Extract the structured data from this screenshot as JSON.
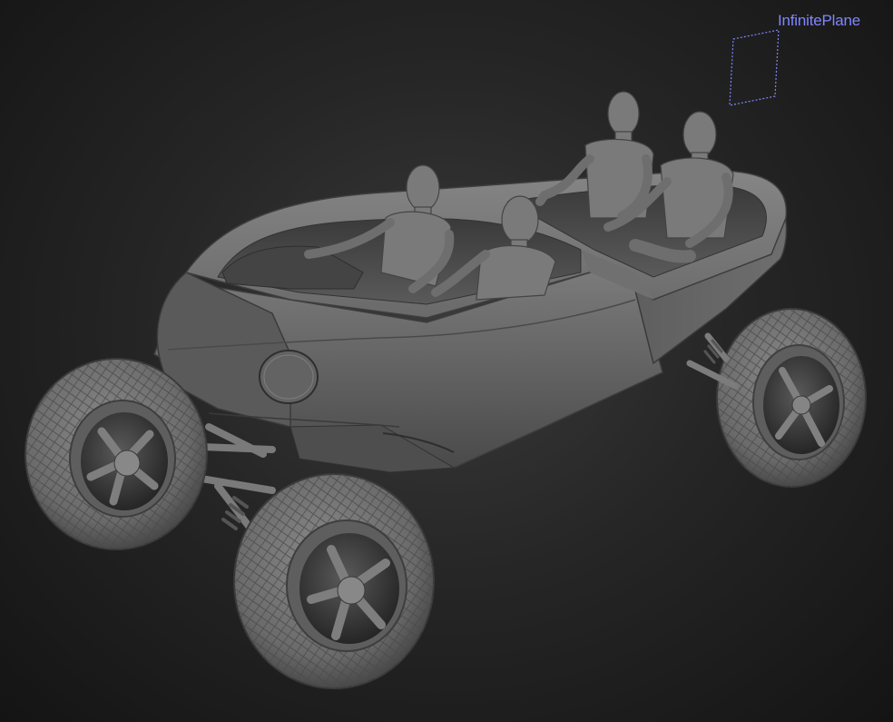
{
  "viewport": {
    "plane_label": "InfinitePlane",
    "label_color": "#7f86ff",
    "background_color": "#262626"
  },
  "model": {
    "icon": "offroad-buggy-model",
    "body_color": "#676767",
    "occupants": 4
  }
}
